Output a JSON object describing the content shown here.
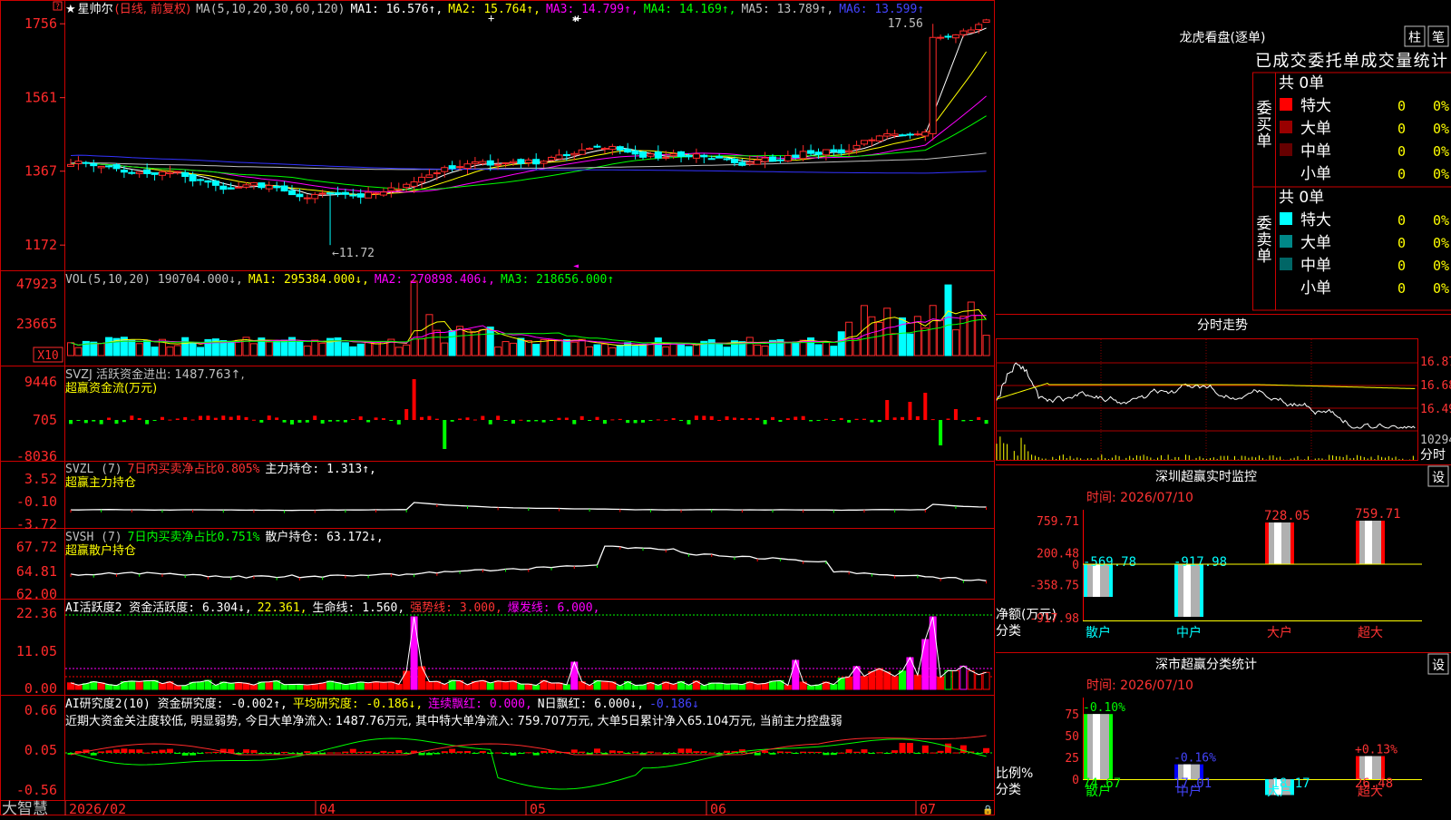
{
  "app": {
    "brand": "大智慧"
  },
  "price": {
    "label_prefix": "★",
    "name": "星帅尔",
    "mode": "(日线, 前复权)",
    "ma_def": "MA(5,10,20,30,60,120)",
    "ma_items": [
      {
        "text": "MA1: 16.576↑,",
        "color": "#ffffff"
      },
      {
        "text": "MA2: 15.764↑,",
        "color": "#ffff00"
      },
      {
        "text": "MA3: 14.799↑,",
        "color": "#ff00ff"
      },
      {
        "text": "MA4: 14.169↑,",
        "color": "#00ff00"
      },
      {
        "text": "MA5: 13.789↑,",
        "color": "#c0c0c0"
      },
      {
        "text": "MA6: 13.599↑",
        "color": "#4444ff"
      }
    ],
    "y_ticks": [
      {
        "v": 17.56,
        "t": "1756"
      },
      {
        "v": 15.61,
        "t": "1561"
      },
      {
        "v": 13.67,
        "t": "1367"
      },
      {
        "v": 11.72,
        "t": "1172"
      }
    ],
    "high_label": "17.56",
    "low_label": "←11.72",
    "ylim": [
      11.15,
      17.9
    ]
  },
  "vol": {
    "title": "VOL(5,10,20)",
    "items": [
      {
        "text": "190704.000↓,",
        "color": "#c0c0c0"
      },
      {
        "text": "MA1: 295384.000↓,",
        "color": "#ffff00"
      },
      {
        "text": "MA2: 270898.406↓,",
        "color": "#ff00ff"
      },
      {
        "text": "MA3: 218656.000↑",
        "color": "#00ff00"
      }
    ],
    "y_ticks": [
      "47923",
      "23665"
    ],
    "unit": "X10"
  },
  "svzj": {
    "title": "SVZJ  活跃资金进出: 1487.763↑,",
    "subtitle": "超赢资金流(万元)",
    "y_ticks": [
      "9446",
      "705",
      "-8036"
    ]
  },
  "svzl": {
    "items": [
      {
        "text": "SVZL (7)",
        "color": "#c0c0c0"
      },
      {
        "text": "7日内买卖净占比0.805%",
        "color": "#ff3333"
      },
      {
        "text": "主力持仓: 1.313↑,",
        "color": "#ffffff"
      }
    ],
    "subtitle": "超赢主力持仓",
    "y_ticks": [
      "3.52",
      "-0.10",
      "-3.72"
    ]
  },
  "svsh": {
    "items": [
      {
        "text": "SVSH (7)",
        "color": "#c0c0c0"
      },
      {
        "text": "7日内买卖净占比0.751%",
        "color": "#00ff00"
      },
      {
        "text": "散户持仓: 63.172↓,",
        "color": "#ffffff"
      }
    ],
    "subtitle": "超赢散户持仓",
    "y_ticks": [
      "67.72",
      "64.81",
      "62.00"
    ]
  },
  "ai2": {
    "items": [
      {
        "text": "AI活跃度2 资金活跃度: 6.304↓,",
        "color": "#ffffff"
      },
      {
        "text": "22.361,",
        "color": "#ffff00"
      },
      {
        "text": "生命线: 1.560,",
        "color": "#ffffff"
      },
      {
        "text": "强势线: 3.000,",
        "color": "#ff3333"
      },
      {
        "text": "爆发线: 6.000,",
        "color": "#ff00ff"
      }
    ],
    "y_ticks": [
      "22.36",
      "11.05",
      "0.00"
    ]
  },
  "aiy": {
    "items": [
      {
        "text": "AI研究度2(10) 资金研究度: -0.002↑,",
        "color": "#ffffff"
      },
      {
        "text": "平均研究度: -0.186↓,",
        "color": "#ffff00"
      },
      {
        "text": "连续飘红: 0.000,",
        "color": "#ff00ff"
      },
      {
        "text": "N日飘红: 6.000↓,",
        "color": "#ffffff"
      },
      {
        "text": "-0.186↓",
        "color": "#4444ff"
      }
    ],
    "comment": "近期大资金关注度较低, 明显弱势, 今日大单净流入: 1487.76万元, 其中特大单净流入: 759.707万元, 大单5日累计净入65.104万元, 当前主力控盘弱",
    "y_ticks": [
      "0.66",
      "0.05",
      "-0.56"
    ]
  },
  "xaxis": {
    "labels": [
      "2026/02",
      "04",
      "05",
      "06",
      "07"
    ]
  },
  "lhb": {
    "title": "龙虎看盘(逐单)",
    "btn_zhu": "柱",
    "btn_bi": "笔",
    "tabs": "已成交委托单成交量统计",
    "buy_label": "委买单",
    "sell_label": "委卖单",
    "buy_total": "共 0单",
    "sell_total": "共 0单",
    "buy_rows": [
      {
        "name": "特大",
        "count": "0",
        "pct": "0%",
        "color": "#ff0000"
      },
      {
        "name": "大单",
        "count": "0",
        "pct": "0%",
        "color": "#990000"
      },
      {
        "name": "中单",
        "count": "0",
        "pct": "0%",
        "color": "#660000"
      },
      {
        "name": "小单",
        "count": "0",
        "pct": "0%",
        "color": ""
      }
    ],
    "sell_rows": [
      {
        "name": "特大",
        "count": "0",
        "pct": "0%",
        "color": "#00ffff"
      },
      {
        "name": "大单",
        "count": "0",
        "pct": "0%",
        "color": "#008888"
      },
      {
        "name": "中单",
        "count": "0",
        "pct": "0%",
        "color": "#006666"
      },
      {
        "name": "小单",
        "count": "0",
        "pct": "0%",
        "color": ""
      }
    ]
  },
  "fenshi": {
    "title": "分时走势",
    "y_ticks": [
      "16.87",
      "16.68",
      "16.49"
    ],
    "vol_label": "10294",
    "footer": "分时"
  },
  "monitor": {
    "title": "深圳超赢实时监控",
    "set": "设",
    "time": "时间: 2026/07/10",
    "y_ticks": [
      "759.71",
      "200.48",
      "0",
      "-358.75",
      "-917.98"
    ],
    "yname1": "净额(万元)",
    "yname2": "分类",
    "bars": [
      {
        "cat": "散户",
        "value": -569.78,
        "label": "-569.78",
        "color": "#00ffff",
        "lcolor": "#00ffff"
      },
      {
        "cat": "中户",
        "value": -917.98,
        "label": "-917.98",
        "color": "#00ffff",
        "lcolor": "#00ffff"
      },
      {
        "cat": "大户",
        "value": 728.05,
        "label": "728.05",
        "color": "#ff0000",
        "lcolor": "#ff3333"
      },
      {
        "cat": "超大",
        "value": 759.71,
        "label": "759.71",
        "color": "#ff0000",
        "lcolor": "#ff3333"
      }
    ]
  },
  "stats": {
    "title": "深市超赢分类统计",
    "set": "设",
    "time": "时间: 2026/07/10",
    "y_ticks": [
      "75",
      "50",
      "25",
      "0"
    ],
    "yname1": "比例%",
    "yname2": "分类",
    "bars": [
      {
        "cat": "散户",
        "value": 74.67,
        "label": "74.67",
        "chg": "-0.10%",
        "color": "#00ff00",
        "lcolor": "#00ff00"
      },
      {
        "cat": "中户",
        "value": 17.01,
        "label": "17.01",
        "chg": "-0.16%",
        "color": "#0000ff",
        "lcolor": "#4444ff"
      },
      {
        "cat": "大户",
        "value": -18.17,
        "label": "-18.17",
        "chg": "",
        "color": "#00ffff",
        "lcolor": "#00ffff"
      },
      {
        "cat": "超大",
        "value": 26.48,
        "label": "26.48",
        "chg": "+0.13%",
        "color": "#ff0000",
        "lcolor": "#ff3333"
      }
    ]
  }
}
